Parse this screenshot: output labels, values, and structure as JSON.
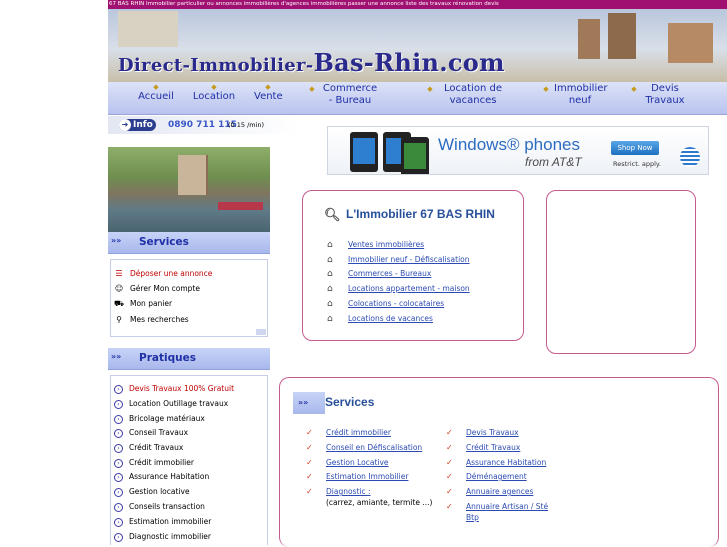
{
  "topline": "67 BAS RHIN Immobilier particulier ou annonces immobilières d'agences immobilières passer une annonce liste des travaux rénovation devis",
  "banner": {
    "title_a": "Direct-Immobilier-",
    "title_b": "Bas-Rhin.com"
  },
  "nav": [
    {
      "label": "Accueil"
    },
    {
      "label": "Location"
    },
    {
      "label": "Vente"
    },
    {
      "label": "Commerce - Bureau"
    },
    {
      "label": "Location de vacances"
    },
    {
      "label": "Immobilier neuf"
    },
    {
      "label": "Devis Travaux"
    }
  ],
  "infobar": {
    "badge": "Info",
    "phone": "0890 711 115",
    "price": "(0.15 /min)"
  },
  "ad": {
    "brand": "Windows® phones",
    "carrier": "from AT&T",
    "button": "Shop Now",
    "note": "Restrict. apply."
  },
  "sidebar": {
    "services_title": "Services",
    "services": [
      {
        "label": "Déposer une annonce",
        "icon": "list-icon"
      },
      {
        "label": "Gérer Mon compte",
        "icon": "person-icon"
      },
      {
        "label": "Mon panier",
        "icon": "cart-icon"
      },
      {
        "label": "Mes recherches",
        "icon": "magnifier-icon"
      }
    ],
    "pratiques_title": "Pratiques",
    "pratiques": [
      "Devis Travaux 100% Gratuit",
      "Location Outillage travaux",
      "Bricolage matériaux",
      "Conseil Travaux",
      "Crédit Travaux",
      "Crédit immobilier",
      "Assurance Habitation",
      "Gestion locative",
      "Conseils transaction",
      "Estimation immobilier",
      "Diagnostic immobilier"
    ]
  },
  "immo": {
    "title": "L'Immobilier 67 BAS RHIN",
    "links": [
      "Ventes immobilières",
      "Immobilier neuf - Défiscalisation",
      "Commerces - Bureaux",
      "Locations appartement - maison",
      "Colocations - colocataires",
      "Locations de vacances"
    ]
  },
  "services": {
    "title": "Services",
    "left": [
      {
        "label": "Crédit immobilier"
      },
      {
        "label": "Conseil en Défiscalisation"
      },
      {
        "label": "Gestion Locative"
      },
      {
        "label": "Estimation Immobilier"
      },
      {
        "label": "Diagnostic :",
        "extra": "(carrez, amiante, termite ...)"
      }
    ],
    "right": [
      {
        "label": "Devis Travaux"
      },
      {
        "label": "Crédit Travaux"
      },
      {
        "label": "Assurance Habitation"
      },
      {
        "label": "Déménagement"
      },
      {
        "label": "Annuaire agences"
      },
      {
        "label": "Annuaire Artisan / Sté Btp"
      }
    ]
  }
}
